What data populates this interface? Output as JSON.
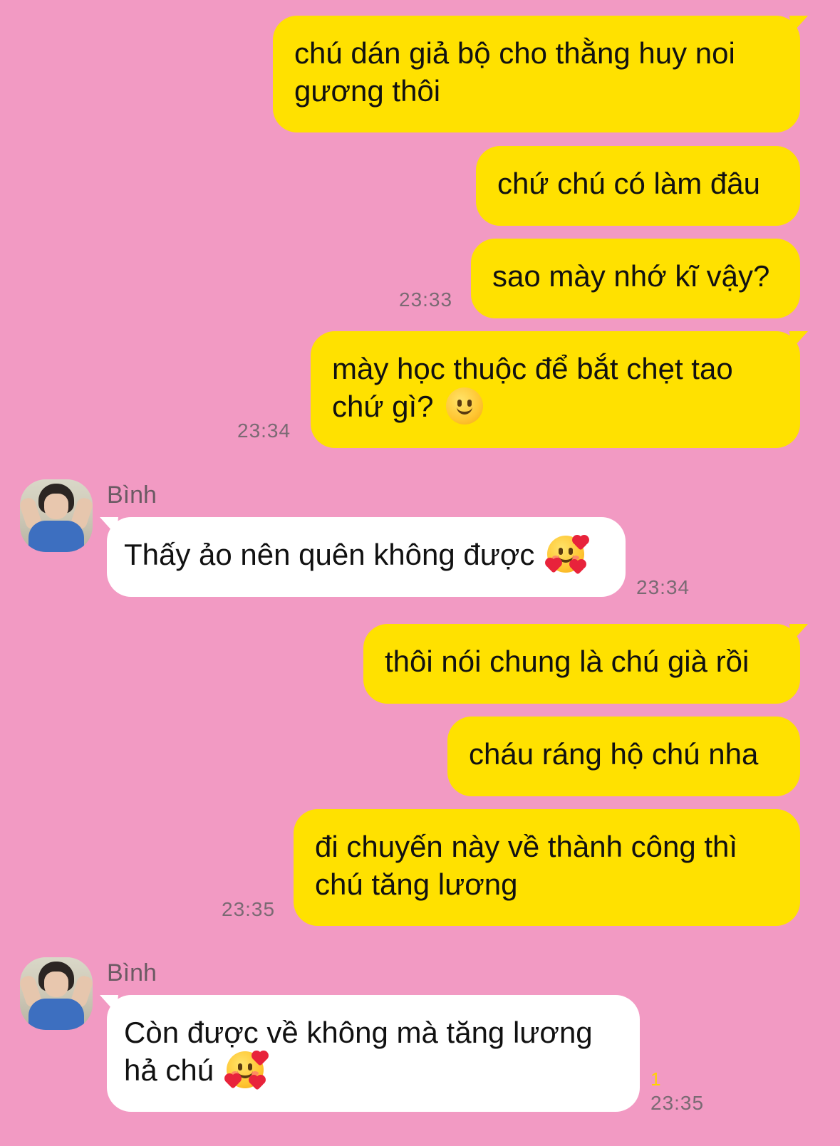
{
  "conversation": {
    "messages": [
      {
        "text": "chú dán giả bộ cho thằng huy noi gương thôi"
      },
      {
        "text": "chứ chú có làm đâu"
      },
      {
        "text": "sao mày nhớ kĩ vậy?",
        "time": "23:33"
      },
      {
        "text": "mày học thuộc để bắt chẹt tao chứ gì?",
        "time": "23:34",
        "emoji": "slight-smile-icon"
      },
      {
        "sender": "Bình",
        "text": "Thấy ảo nên quên không được",
        "time": "23:34",
        "emoji": "smiling-face-with-hearts-icon"
      },
      {
        "text": "thôi nói chung là chú già rồi"
      },
      {
        "text": "cháu ráng hộ chú nha"
      },
      {
        "text": "đi chuyến này về thành công thì chú tăng lương",
        "time": "23:35"
      },
      {
        "sender": "Bình",
        "text": "Còn được về không mà tăng lương hả chú",
        "time": "23:35",
        "read_count": "1",
        "emoji": "smiling-face-with-hearts-icon"
      }
    ]
  },
  "colors": {
    "background": "#f29ac3",
    "outgoing_bubble": "#ffe100",
    "incoming_bubble": "#ffffff",
    "timestamp": "#7a6a73",
    "read_count": "#ffd400"
  }
}
